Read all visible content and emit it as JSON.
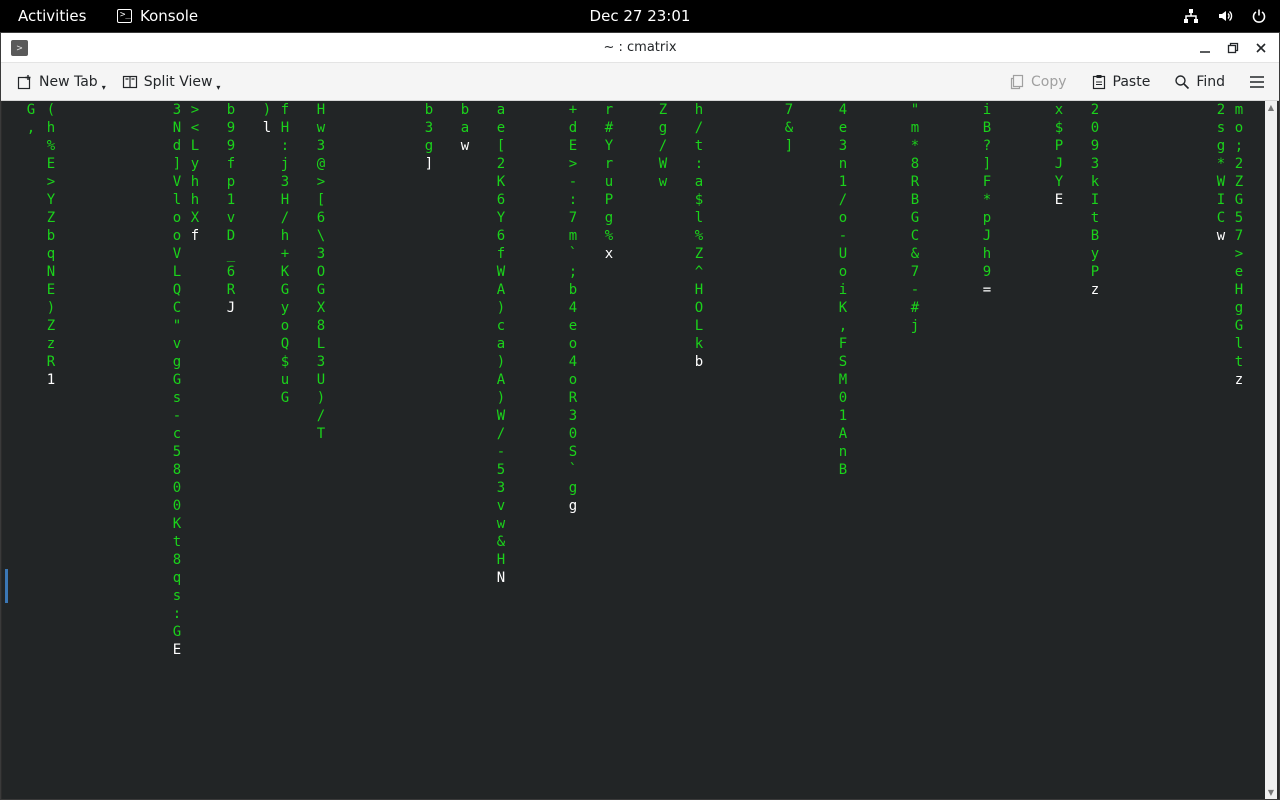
{
  "topbar": {
    "activities": "Activities",
    "app_name": "Konsole",
    "clock": "Dec 27  23:01",
    "tray_icons": [
      "network-icon",
      "volume-icon",
      "power-icon"
    ]
  },
  "window": {
    "title": "~ : cmatrix",
    "controls": [
      "minimize-icon",
      "maximize-icon",
      "close-icon"
    ]
  },
  "toolbar": {
    "new_tab": "New Tab",
    "split_view": "Split View",
    "copy": "Copy",
    "paste": "Paste",
    "find": "Find"
  },
  "terminal": {
    "program": "cmatrix",
    "text_color": "#1bd21b",
    "head_color": "#ffffff",
    "background": "#222526",
    "columns": [
      {
        "text": "G,",
        "head": ""
      },
      {
        "text": "(h%E>YZbqNE)ZzR",
        "head": "1"
      },
      {
        "text": "3Nd]VlooVLQC\"vgGs-c5800Kt8qs:G",
        "head": "E"
      },
      {
        "text": "><LyhhX",
        "head": "f"
      },
      {
        "text": "b99fp1vD_6R",
        "head": "J"
      },
      {
        "text": ")",
        "head": "l"
      },
      {
        "text": "fH:j3H/h+KGyoQ$uG",
        "head": ""
      },
      {
        "text": "Hw3@>[6\\3OGX8L3U)/T",
        "head": ""
      },
      {
        "text": "b3g",
        "head": "]"
      },
      {
        "text": "ba",
        "head": "w"
      },
      {
        "text": "ae[2K6Y6fWA)ca)A)W/-53vw&H",
        "head": "N"
      },
      {
        "text": "+dE>-:7m`;b4eo4oR30S`g",
        "head": "g"
      },
      {
        "text": "r#YruPg%",
        "head": "x"
      },
      {
        "text": "Zg/Ww",
        "head": ""
      },
      {
        "text": "h/t:a$l%Z^HOLk",
        "head": "b"
      },
      {
        "text": "7&]",
        "head": ""
      },
      {
        "text": "4e3n1/o-UoiK,FSM01AnB",
        "head": ""
      },
      {
        "text": "\"m*8RBGC&7-#j",
        "head": ""
      },
      {
        "text": "iB?]F*pJh9",
        "head": "="
      },
      {
        "text": "x$PJY",
        "head": "E"
      },
      {
        "text": "2093kItByP",
        "head": "z"
      },
      {
        "text": "2sg*WIC",
        "head": "w"
      },
      {
        "text": "mo;2ZG57>eHgGlt",
        "head": "z"
      }
    ]
  }
}
